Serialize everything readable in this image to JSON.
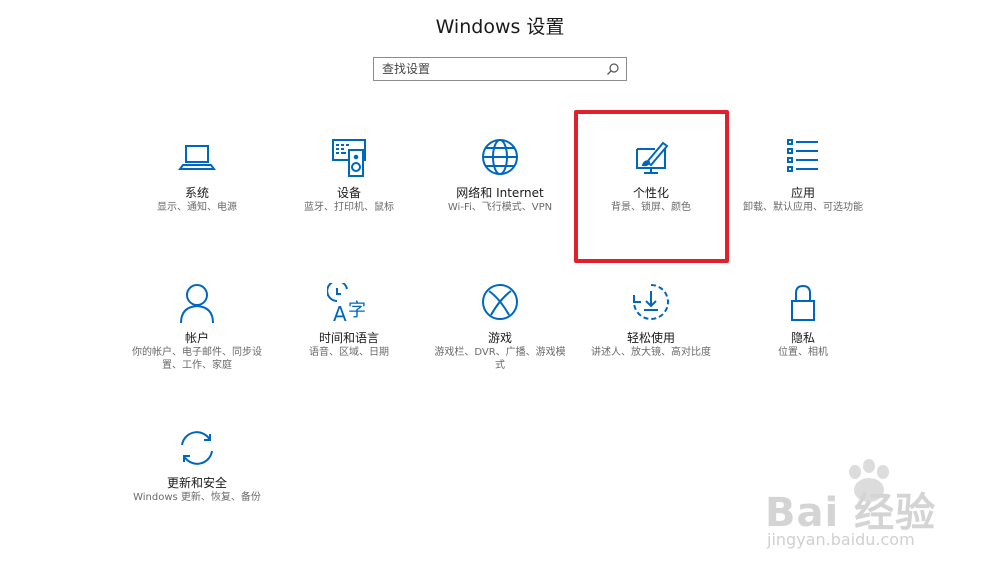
{
  "window": {
    "title": "Windows 设置"
  },
  "search": {
    "placeholder": "查找设置"
  },
  "tiles": [
    {
      "name": "系统",
      "desc": "显示、通知、电源",
      "icon": "laptop-icon"
    },
    {
      "name": "设备",
      "desc": "蓝牙、打印机、鼠标",
      "icon": "devices-icon"
    },
    {
      "name": "网络和 Internet",
      "desc": "Wi-Fi、飞行模式、VPN",
      "icon": "globe-icon"
    },
    {
      "name": "个性化",
      "desc": "背景、锁屏、颜色",
      "icon": "personalization-icon"
    },
    {
      "name": "应用",
      "desc": "卸载、默认应用、可选功能",
      "icon": "apps-list-icon"
    },
    {
      "name": "帐户",
      "desc": "你的帐户、电子邮件、同步设置、工作、家庭",
      "icon": "person-icon"
    },
    {
      "name": "时间和语言",
      "desc": "语音、区域、日期",
      "icon": "time-language-icon"
    },
    {
      "name": "游戏",
      "desc": "游戏栏、DVR、广播、游戏模式",
      "icon": "xbox-icon"
    },
    {
      "name": "轻松使用",
      "desc": "讲述人、放大镜、高对比度",
      "icon": "ease-of-access-icon"
    },
    {
      "name": "隐私",
      "desc": "位置、相机",
      "icon": "lock-icon"
    },
    {
      "name": "更新和安全",
      "desc": "Windows 更新、恢复、备份",
      "icon": "sync-icon"
    }
  ],
  "highlight": {
    "tile": "个性化",
    "color": "#e0202a"
  },
  "accent_color": "#0067c0",
  "watermark": {
    "logo": "Bai 经验",
    "url": "jingyan.baidu.com"
  }
}
